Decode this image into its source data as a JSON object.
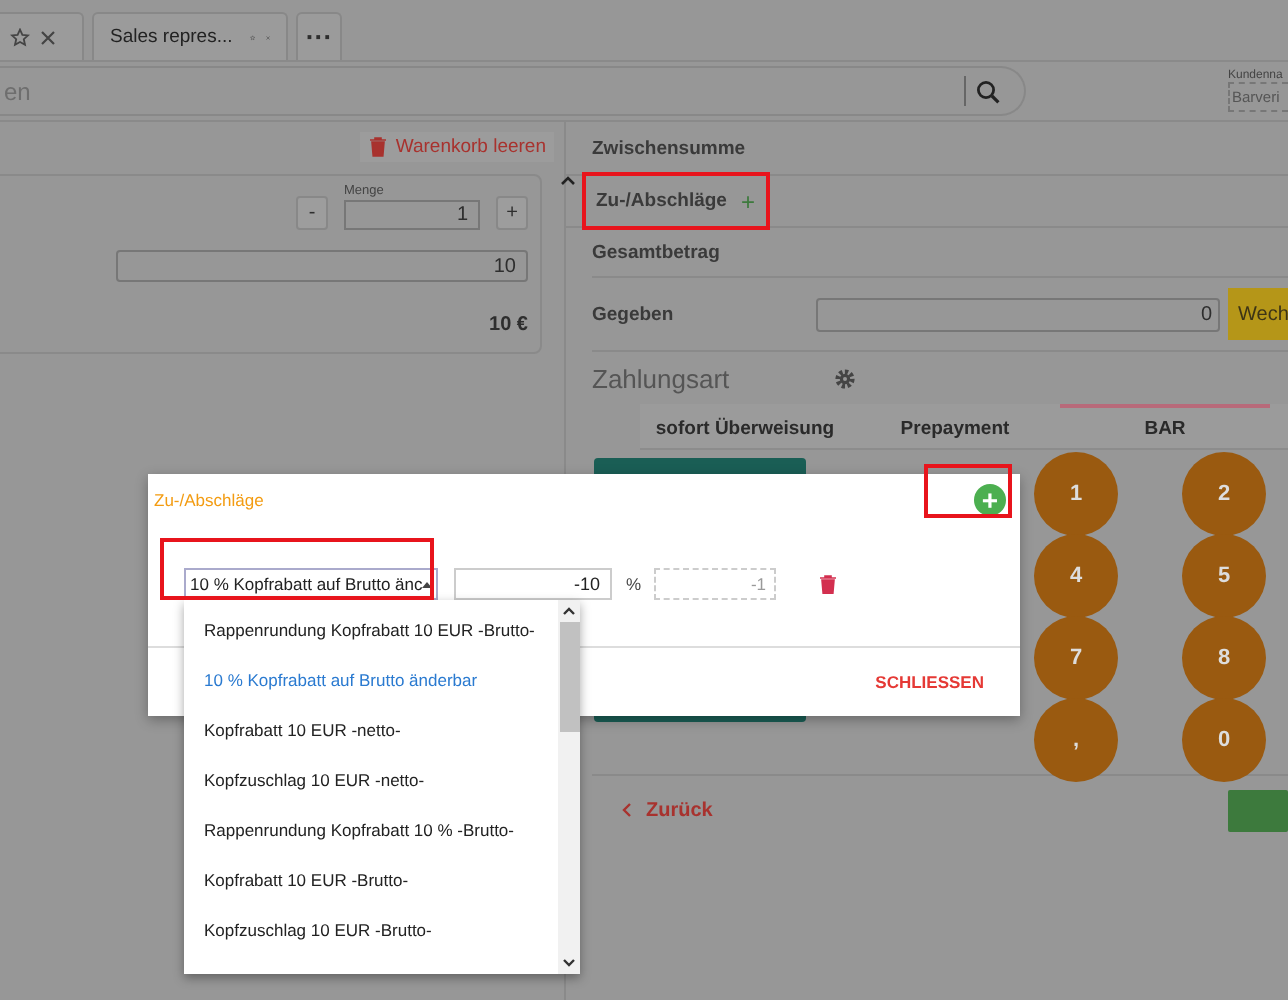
{
  "tabs": [
    {
      "kind": "cut"
    },
    {
      "kind": "named",
      "label": "Sales repres..."
    },
    {
      "kind": "more",
      "label": "···"
    }
  ],
  "search": {
    "placeholder": "en"
  },
  "customer": {
    "label": "Kundenna",
    "value": "Barveri"
  },
  "cart": {
    "clear_button": "Warenkorb leeren",
    "quantity_label": "Menge",
    "decrement": "-",
    "quantity": "1",
    "increment": "+",
    "price": "10",
    "total": "10 €"
  },
  "summary": [
    {
      "kind": "plain",
      "label": "Zwischensumme"
    },
    {
      "kind": "add",
      "label": "Zu-/Abschläge",
      "action": "+"
    },
    {
      "kind": "plain",
      "label": "Gesamtbetrag"
    },
    {
      "kind": "input",
      "label": "Gegeben",
      "value": "0",
      "button": "Wech"
    }
  ],
  "payment": {
    "title": "Zahlungsart",
    "tabs": [
      {
        "label": "sofort Überweisung",
        "selected": false
      },
      {
        "label": "Prepayment",
        "selected": false
      },
      {
        "label": "BAR",
        "selected": true
      }
    ],
    "keys": [
      "1",
      "2",
      "4",
      "5",
      "7",
      "8",
      ",",
      "0"
    ],
    "back": "Zurück"
  },
  "dialog": {
    "title": "Zu-/Abschläge",
    "add": "+",
    "select_value": "10 % Kopfrabatt auf Brutto änc",
    "amount": "-10",
    "unit": "%",
    "quantity": "-1",
    "close": "SCHLIESSEN"
  },
  "dropdown": [
    {
      "label": "Rappenrundung Kopfrabatt 10 EUR -Brutto-",
      "selected": false
    },
    {
      "label": "10 % Kopfrabatt auf Brutto änderbar",
      "selected": true
    },
    {
      "label": "Kopfrabatt 10 EUR -netto-",
      "selected": false
    },
    {
      "label": "Kopfzuschlag 10 EUR -netto-",
      "selected": false
    },
    {
      "label": "Rappenrundung Kopfrabatt 10 % -Brutto-",
      "selected": false
    },
    {
      "label": "Kopfrabatt 10 EUR -Brutto-",
      "selected": false
    },
    {
      "label": "Kopfzuschlag 10 EUR -Brutto-",
      "selected": false
    }
  ]
}
